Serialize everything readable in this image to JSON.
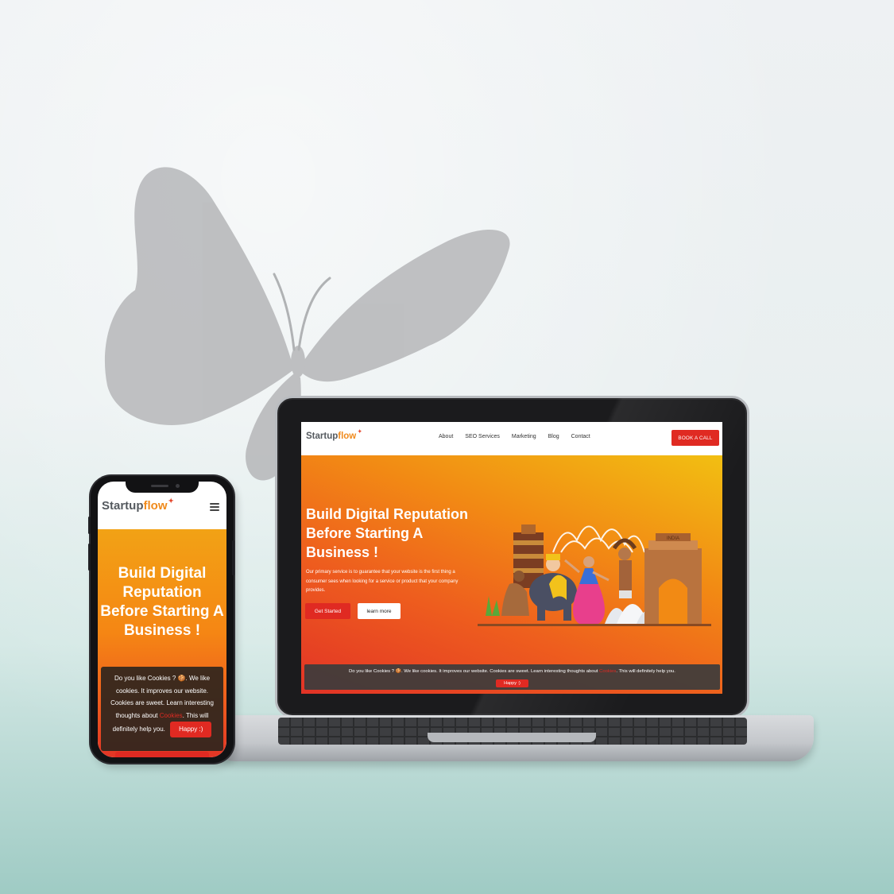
{
  "brand": {
    "name_part1": "Startup",
    "name_part2": "flow"
  },
  "nav": {
    "items": [
      "About",
      "SEO Services",
      "Marketing",
      "Blog",
      "Contact"
    ],
    "cta": "BOOK A CALL"
  },
  "hero": {
    "headline": "Build Digital Reputation Before Starting A Business !",
    "description": "Our primary service is to guarantee that your website is the first thing a consumer sees when looking for a service or product that your company provides.",
    "primary_button": "Get Started",
    "secondary_button": "learn more",
    "illustration_sign": "INDIA"
  },
  "cookie": {
    "part1": "Do you like Cookies ?",
    "part2": ". We like cookies. It improves our website. Cookies are sweet. Learn interesting thoughts about",
    "link": "Cookies",
    "part3": ". This will definitely help you.",
    "button": "Happy :)"
  },
  "colors": {
    "accent_red": "#e02a22",
    "brand_orange": "#f08a1c",
    "hero_yellow": "#f2bf12"
  },
  "icons": [
    "butterfly-silhouette-icon",
    "hamburger-menu-icon",
    "cookie-icon",
    "logo-mark-icon"
  ]
}
